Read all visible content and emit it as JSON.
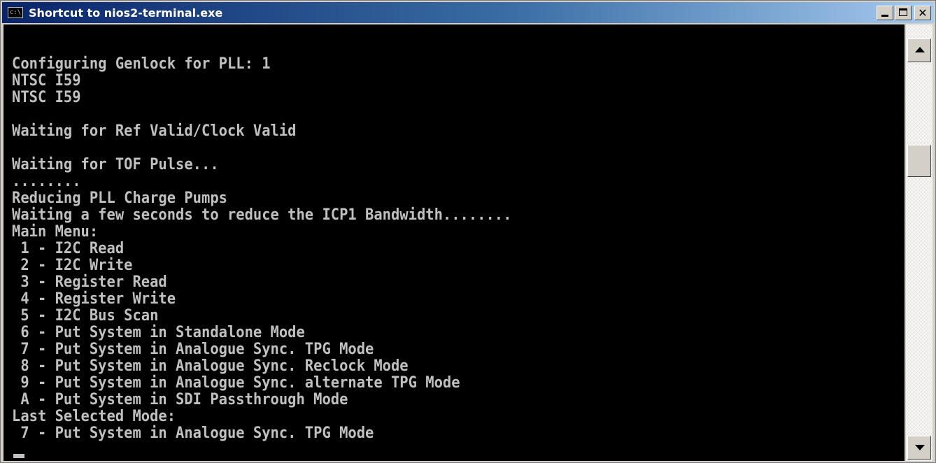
{
  "window": {
    "title": "Shortcut to nios2-terminal.exe",
    "icon": "console-icon",
    "icon_text": "c:\\",
    "buttons": {
      "minimize": "minimize-icon",
      "maximize": "maximize-icon",
      "close": "close-icon",
      "close_glyph": "✕"
    }
  },
  "console": {
    "lines": [
      "Configuring Genlock for PLL: 1",
      "NTSC I59",
      "NTSC I59",
      "",
      "Waiting for Ref Valid/Clock Valid",
      "",
      "Waiting for TOF Pulse...",
      "........",
      "Reducing PLL Charge Pumps",
      "Waiting a few seconds to reduce the ICP1 Bandwidth........",
      "Main Menu:",
      " 1 - I2C Read",
      " 2 - I2C Write",
      " 3 - Register Read",
      " 4 - Register Write",
      " 5 - I2C Bus Scan",
      " 6 - Put System in Standalone Mode",
      " 7 - Put System in Analogue Sync. TPG Mode",
      " 8 - Put System in Analogue Sync. Reclock Mode",
      " 9 - Put System in Analogue Sync. alternate TPG Mode",
      " A - Put System in SDI Passthrough Mode",
      "Last Selected Mode:",
      " 7 - Put System in Analogue Sync. TPG Mode"
    ],
    "text_color": "#c0c0c0",
    "background": "#000000"
  },
  "scrollbar": {
    "up": "scroll-up-arrow-icon",
    "down": "scroll-down-arrow-icon"
  }
}
